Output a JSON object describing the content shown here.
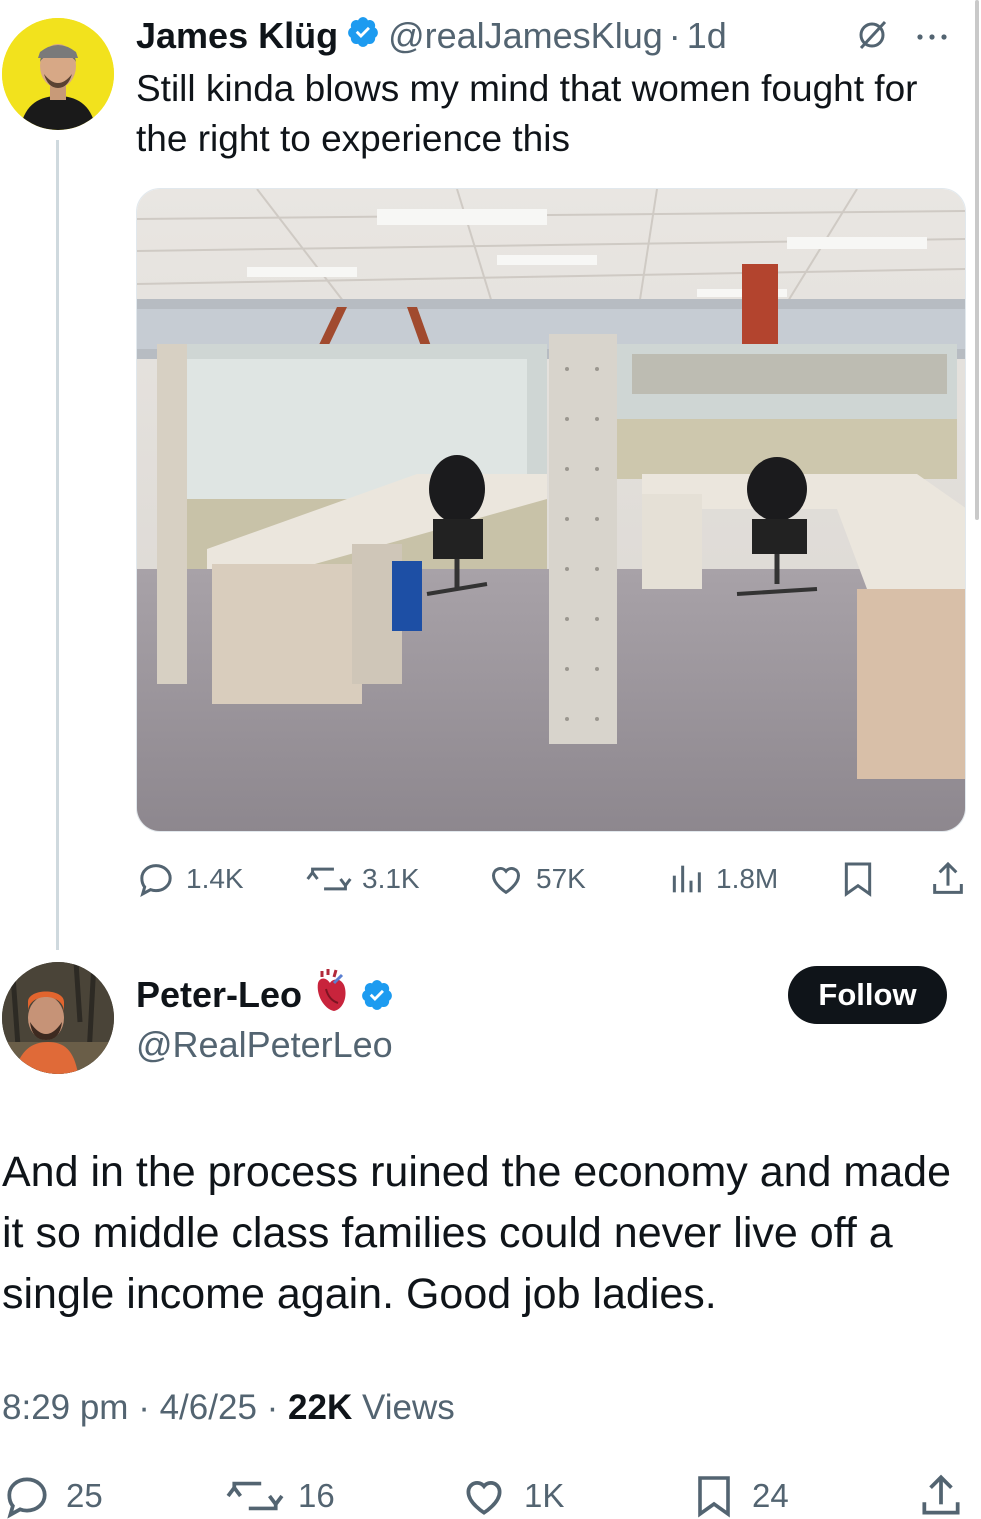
{
  "parent_tweet": {
    "display_name": "James Klüg",
    "handle": "@realJamesKlug",
    "separator": "·",
    "time_ago": "1d",
    "text": "Still kinda blows my mind that women fought for the right to experience this",
    "stats": {
      "replies": "1.4K",
      "reposts": "3.1K",
      "likes": "57K",
      "views": "1.8M"
    }
  },
  "reply_tweet": {
    "display_name": "Peter-Leo",
    "handle": "@RealPeterLeo",
    "follow_label": "Follow",
    "text": "And in the process ruined the economy and made it so middle class families could never live off a single income again. Good job ladies.",
    "meta": {
      "time": "8:29 pm",
      "separator": "·",
      "date": "4/6/25",
      "views_count": "22K",
      "views_label": "Views"
    },
    "stats": {
      "replies": "25",
      "reposts": "16",
      "likes": "1K",
      "bookmarks": "24"
    }
  },
  "colors": {
    "text_primary": "#0f1419",
    "text_secondary": "#536471",
    "verified_blue": "#1d9bf0",
    "follow_bg": "#0f1419",
    "avatar1_bg": "#f2e21d"
  },
  "icons": [
    "verified-badge-icon",
    "grok-icon",
    "more-icon",
    "reply-icon",
    "repost-icon",
    "like-icon",
    "views-icon",
    "bookmark-icon",
    "share-icon",
    "anatomical-heart-emoji"
  ]
}
